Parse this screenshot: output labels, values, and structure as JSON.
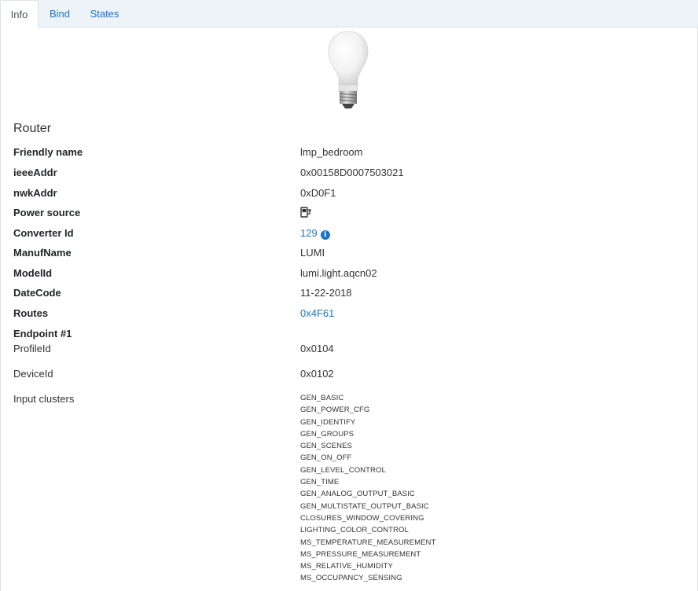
{
  "tabs": [
    {
      "label": "Info",
      "active": true
    },
    {
      "label": "Bind",
      "active": false
    },
    {
      "label": "States",
      "active": false
    }
  ],
  "device": {
    "type_heading": "Router",
    "image_icon": "light-bulb-icon",
    "fields": {
      "friendly_name": {
        "label": "Friendly name",
        "value": "lmp_bedroom"
      },
      "ieee_addr": {
        "label": "ieeeAddr",
        "value": "0x00158D0007503021"
      },
      "nwk_addr": {
        "label": "nwkAddr",
        "value": "0xD0F1"
      },
      "power_source": {
        "label": "Power source",
        "icon": "mains-power-icon"
      },
      "converter_id": {
        "label": "Converter Id",
        "value": "129",
        "icon": "info-circle-icon"
      },
      "manuf_name": {
        "label": "ManufName",
        "value": "LUMI"
      },
      "model_id": {
        "label": "ModelId",
        "value": "lumi.light.aqcn02"
      },
      "date_code": {
        "label": "DateCode",
        "value": "11-22-2018"
      },
      "routes": {
        "label": "Routes",
        "value": "0x4F61"
      }
    }
  },
  "endpoint": {
    "title": "Endpoint #1",
    "profile_id": {
      "label": "ProfileId",
      "value": "0x0104"
    },
    "device_id": {
      "label": "DeviceId",
      "value": "0x0102"
    },
    "input_clusters": {
      "label": "Input clusters",
      "items": [
        "GEN_BASIC",
        "GEN_POWER_CFG",
        "GEN_IDENTIFY",
        "GEN_GROUPS",
        "GEN_SCENES",
        "GEN_ON_OFF",
        "GEN_LEVEL_CONTROL",
        "GEN_TIME",
        "GEN_ANALOG_OUTPUT_BASIC",
        "GEN_MULTISTATE_OUTPUT_BASIC",
        "CLOSURES_WINDOW_COVERING",
        "LIGHTING_COLOR_CONTROL",
        "MS_TEMPERATURE_MEASUREMENT",
        "MS_PRESSURE_MEASUREMENT",
        "MS_RELATIVE_HUMIDITY",
        "MS_OCCUPANCY_SENSING"
      ]
    }
  },
  "colors": {
    "link": "#1a73c8",
    "tabbar_bg": "#eef3f7"
  }
}
